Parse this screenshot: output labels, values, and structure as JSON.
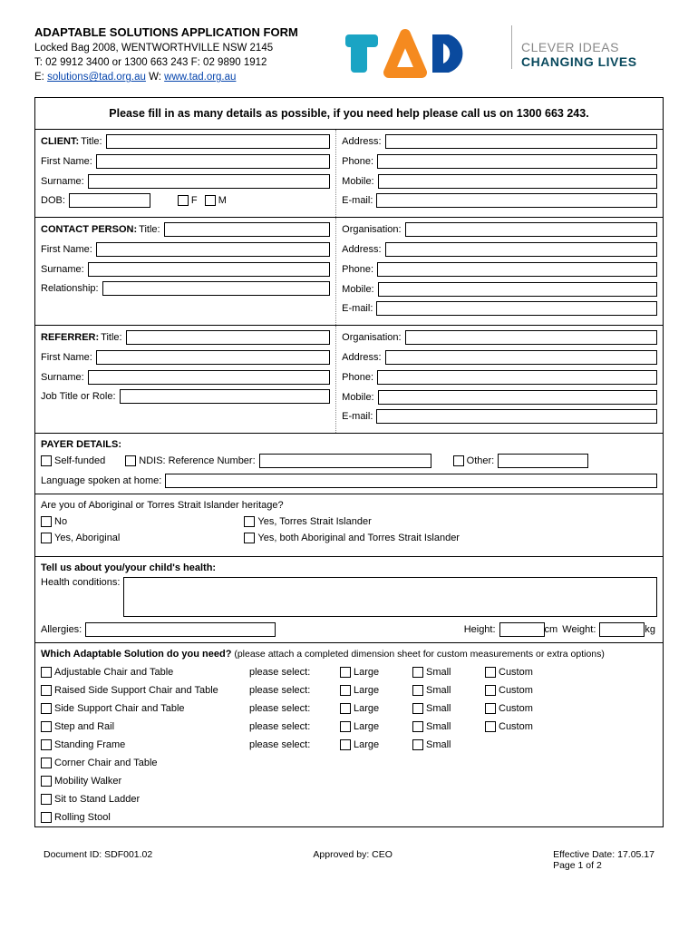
{
  "header": {
    "title": "ADAPTABLE SOLUTIONS APPLICATION FORM",
    "address": "Locked Bag 2008, WENTWORTHVILLE NSW 2145",
    "phone_line": "T: 02 9912 3400 or 1300 663 243  F: 02 9890 1912",
    "email_prefix": "E: ",
    "email": "solutions@tad.org.au",
    "web_prefix": "  W: ",
    "web": "www.tad.org.au",
    "tagline1": "CLEVER IDEAS",
    "tagline2": "CHANGING LIVES"
  },
  "form": {
    "instructions": "Please fill in as many details as possible, if you need help please call us on 1300 663 243.",
    "client": {
      "section_label": "CLIENT:",
      "title": "Title:",
      "first_name": "First Name:",
      "surname": "Surname:",
      "dob": "DOB:",
      "f": "F",
      "m": "M",
      "address": "Address:",
      "phone": "Phone:",
      "mobile": "Mobile:",
      "email": "E-mail:"
    },
    "contact": {
      "section_label": "CONTACT PERSON:",
      "title": "Title:",
      "first_name": "First Name:",
      "surname": "Surname:",
      "relationship": "Relationship:",
      "organisation": "Organisation:",
      "address": "Address:",
      "phone": "Phone:",
      "mobile": "Mobile:",
      "email": "E-mail:"
    },
    "referrer": {
      "section_label": "REFERRER:",
      "title": "Title:",
      "first_name": "First Name:",
      "surname": "Surname:",
      "job": "Job Title or Role:",
      "organisation": "Organisation:",
      "address": "Address:",
      "phone": "Phone:",
      "mobile": "Mobile:",
      "email": "E-mail:"
    },
    "payer": {
      "title": "PAYER DETAILS:",
      "self": "Self-funded",
      "ndis": "NDIS:  Reference Number:",
      "other": "Other:",
      "language": "Language spoken at home:"
    },
    "heritage": {
      "question": "Are you of Aboriginal or Torres Strait Islander heritage?",
      "no": "No",
      "tsi": "Yes, Torres Strait Islander",
      "abo": "Yes, Aboriginal",
      "both": "Yes, both Aboriginal and Torres Strait Islander"
    },
    "health": {
      "title": "Tell us about you/your child's health:",
      "conditions": "Health conditions:",
      "allergies": "Allergies:",
      "height": "Height:",
      "height_unit": "cm",
      "weight": "Weight:",
      "weight_unit": "kg"
    },
    "solutions": {
      "title": "Which Adaptable Solution do you need?",
      "note": " (please attach a completed dimension sheet for custom measurements or extra options)",
      "please_select": "please select:",
      "large": "Large",
      "small": "Small",
      "custom": "Custom",
      "items": [
        {
          "name": "Adjustable Chair and Table",
          "sel": true,
          "custom": true
        },
        {
          "name": "Raised Side Support Chair and Table",
          "sel": true,
          "custom": true
        },
        {
          "name": "Side Support Chair and Table",
          "sel": true,
          "custom": true
        },
        {
          "name": "Step and Rail",
          "sel": true,
          "custom": true
        },
        {
          "name": "Standing Frame",
          "sel": true,
          "custom": false
        },
        {
          "name": "Corner Chair and Table",
          "sel": false,
          "custom": false
        },
        {
          "name": "Mobility Walker",
          "sel": false,
          "custom": false
        },
        {
          "name": "Sit to Stand Ladder",
          "sel": false,
          "custom": false
        },
        {
          "name": "Rolling Stool",
          "sel": false,
          "custom": false
        }
      ]
    }
  },
  "footer": {
    "doc_id": "Document ID: SDF001.02",
    "approved": "Approved by: CEO",
    "effective": "Effective Date: 17.05.17",
    "page": "Page 1 of 2"
  }
}
